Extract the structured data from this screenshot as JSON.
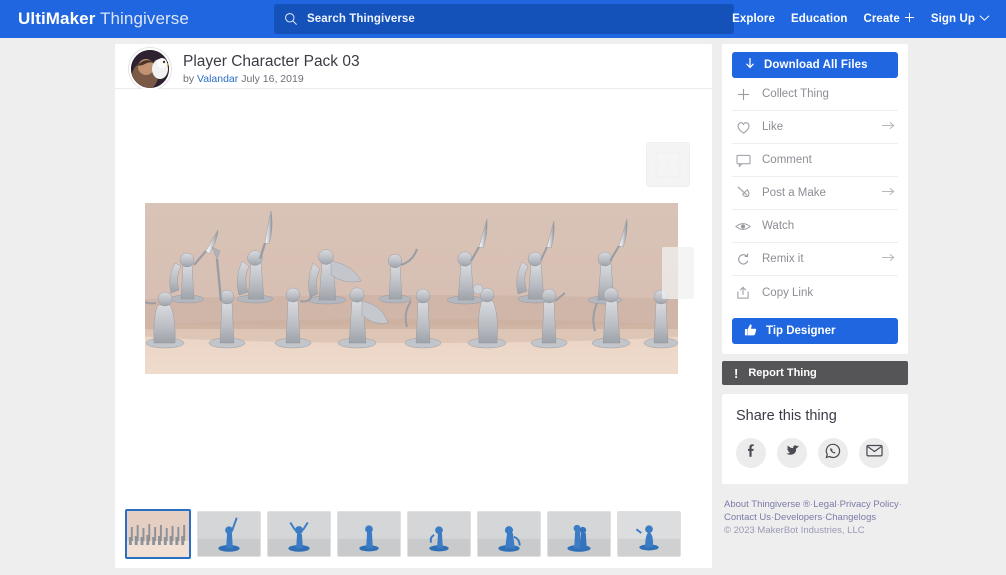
{
  "header": {
    "brand_bold": "UltiMaker",
    "brand_light": "Thingiverse",
    "search_placeholder": "Search Thingiverse",
    "search_value": "",
    "nav": [
      {
        "label": "Explore",
        "icon": ""
      },
      {
        "label": "Education",
        "icon": ""
      },
      {
        "label": "Create",
        "icon": "plus-icon"
      },
      {
        "label": "Sign Up",
        "icon": "chevron-down-icon"
      }
    ]
  },
  "thing": {
    "title": "Player Character Pack 03",
    "by_prefix": "by ",
    "author": "Valandar",
    "date": " July 16, 2019",
    "avatar_alt": "user-avatar",
    "image_alt": "Gray resin miniature figurines group photo",
    "expand_label": "expand-image",
    "next_label": "next-image"
  },
  "thumbnails": [
    {
      "alt": "group of gray miniatures",
      "selected": true,
      "kind": "group"
    },
    {
      "alt": "blue printed figurine 1",
      "selected": false,
      "kind": "figure"
    },
    {
      "alt": "blue printed figurine 2",
      "selected": false,
      "kind": "figure"
    },
    {
      "alt": "blue printed figurine 3",
      "selected": false,
      "kind": "figure"
    },
    {
      "alt": "blue printed figurine 4",
      "selected": false,
      "kind": "figure"
    },
    {
      "alt": "blue printed figurine 5",
      "selected": false,
      "kind": "figure"
    },
    {
      "alt": "blue printed figurine 6",
      "selected": false,
      "kind": "figure"
    },
    {
      "alt": "blue printed figurine 7",
      "selected": false,
      "kind": "figure"
    }
  ],
  "sidebar": {
    "download_label": "Download All Files",
    "download_icon": "download-arrow-icon",
    "actions": [
      {
        "label": "Collect Thing",
        "icon": "plus-icon",
        "arrow": false
      },
      {
        "label": "Like",
        "icon": "heart-icon",
        "arrow": true
      },
      {
        "label": "Comment",
        "icon": "comment-icon",
        "arrow": false
      },
      {
        "label": "Post a Make",
        "icon": "make-icon",
        "arrow": true
      },
      {
        "label": "Watch",
        "icon": "eye-icon",
        "arrow": false
      },
      {
        "label": "Remix it",
        "icon": "remix-icon",
        "arrow": true
      },
      {
        "label": "Copy Link",
        "icon": "share-up-icon",
        "arrow": false
      }
    ],
    "tip_label": "Tip Designer",
    "tip_icon": "thumbs-up-icon",
    "report_label": "Report Thing",
    "report_icon": "exclamation-icon"
  },
  "share": {
    "heading": "Share this thing",
    "buttons": [
      {
        "name": "facebook-icon",
        "label": "Facebook"
      },
      {
        "name": "twitter-icon",
        "label": "Twitter"
      },
      {
        "name": "whatsapp-icon",
        "label": "WhatsApp"
      },
      {
        "name": "email-icon",
        "label": "Email"
      }
    ]
  },
  "footer": {
    "line1": [
      {
        "text": "About Thingiverse ®"
      },
      {
        "text": "Legal"
      },
      {
        "text": "Privacy Policy"
      }
    ],
    "line2": [
      {
        "text": "Contact Us"
      },
      {
        "text": "Developers"
      },
      {
        "text": "Changelogs"
      }
    ],
    "copyright_prefix": "© 2023 ",
    "copyright_company": "MakerBot Industries, LLC"
  },
  "colors": {
    "brand_blue": "#1f66e0",
    "search_blue": "#1451b8",
    "page_bg": "#eeeeee",
    "report_gray": "#555558",
    "link_blue": "#2a6ec6"
  }
}
